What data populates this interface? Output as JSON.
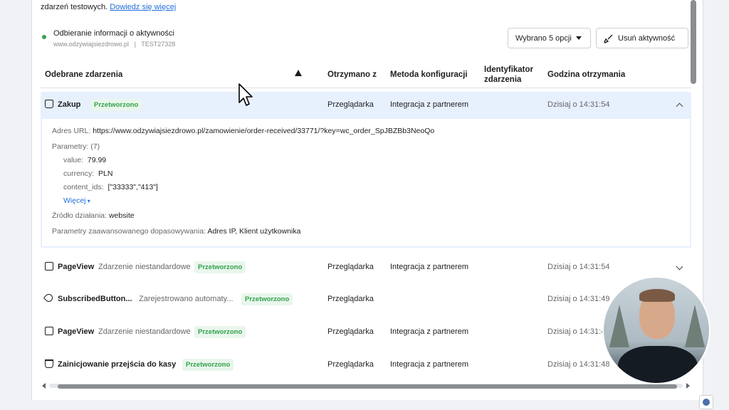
{
  "intro": {
    "text": "zdarzeń testowych.",
    "link": "Dowiedz się więcej"
  },
  "status": {
    "title": "Odbieranie informacji o aktywności",
    "domain": "www.odzywiajsiezdrowo.pl",
    "separator": "|",
    "code": "TEST27328",
    "color": "#31a24c"
  },
  "toolbar": {
    "options_label": "Wybrano 5 opcji",
    "remove_label": "Usuń aktywność"
  },
  "table": {
    "headers": {
      "events": "Odebrane zdarzenia",
      "received_from": "Otrzymano z",
      "config_method": "Metoda konfiguracji",
      "event_id": "Identyfikator zdarzenia",
      "received_time": "Godzina otrzymania"
    },
    "rows": [
      {
        "icon": "shopping-bag-icon",
        "name": "Zakup",
        "type": "",
        "status": "Przetworzono",
        "from": "Przeglądarka",
        "method": "Integracja z partnerem",
        "time": "Dzisiaj o 14:31:54",
        "expanded": true
      },
      {
        "icon": "page-icon",
        "name": "PageView",
        "type": "Zdarzenie niestandardowe",
        "status": "Przetworzono",
        "from": "Przeglądarka",
        "method": "Integracja z partnerem",
        "time": "Dzisiaj o 14:31:54"
      },
      {
        "icon": "tag-icon",
        "name": "SubscribedButton...",
        "type": "Zarejestrowano automaty...",
        "status": "Przetworzono",
        "from": "Przeglądarka",
        "method": "",
        "time": "Dzisiaj o 14:31:49"
      },
      {
        "icon": "page-icon",
        "name": "PageView",
        "type": "Zdarzenie niestandardowe",
        "status": "Przetworzono",
        "from": "Przeglądarka",
        "method": "Integracja z partnerem",
        "time": "Dzisiaj o 14:31:4"
      },
      {
        "icon": "basket-icon",
        "name": "Zainicjowanie przejścia do kasy",
        "type": "",
        "status": "Przetworzono",
        "from": "Przeglądarka",
        "method": "Integracja z partnerem",
        "time": "Dzisiaj o 14:31:48"
      }
    ]
  },
  "details": {
    "url_label": "Adres URL:",
    "url": "https://www.odzywiajsiezdrowo.pl/zamowienie/order-received/33771/?key=wc_order_SpJBZBb3NeoQo",
    "params_label": "Parametry: (7)",
    "params": [
      {
        "key": "value:",
        "val": "79.99"
      },
      {
        "key": "currency:",
        "val": "PLN"
      },
      {
        "key": "content_ids:",
        "val": "[\"33333\",\"413\"]"
      }
    ],
    "more_label": "Więcej",
    "source_label": "Źródło działania:",
    "source": "website",
    "matching_label": "Parametry zaawansowanego dopasowywania:",
    "matching": "Adres IP, Klient użytkownika"
  },
  "colors": {
    "accent": "#216fdb",
    "status_green": "#31a24c",
    "row_highlight": "#e7f0fd"
  }
}
